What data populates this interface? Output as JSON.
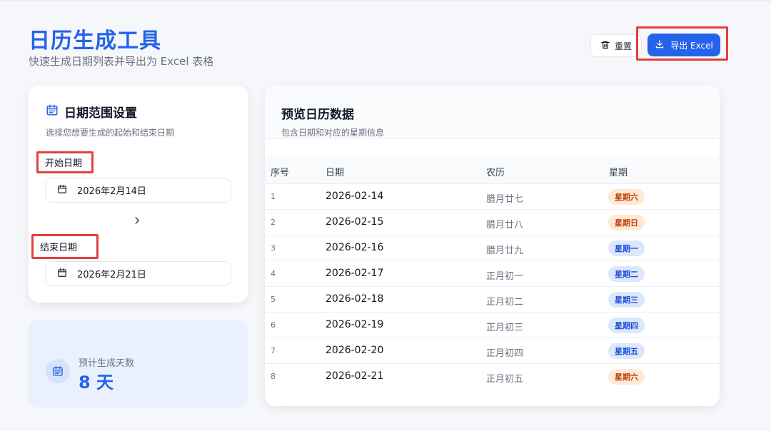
{
  "header": {
    "title": "日历生成工具",
    "subtitle": "快速生成日期列表并导出为 Excel 表格",
    "reset_label": "重置",
    "export_label": "导出 Excel"
  },
  "settings": {
    "title": "日期范围设置",
    "description": "选择您想要生成的起始和结束日期",
    "start_label": "开始日期",
    "start_value": "2026年2月14日",
    "end_label": "结束日期",
    "end_value": "2026年2月21日"
  },
  "summary": {
    "label": "预计生成天数",
    "value": "8 天"
  },
  "preview": {
    "title": "预览日历数据",
    "description": "包含日期和对应的星期信息",
    "columns": [
      "序号",
      "日期",
      "农历",
      "星期"
    ],
    "rows": [
      {
        "idx": "1",
        "date": "2026-02-14",
        "lunar": "腊月廿七",
        "weekday": "星期六",
        "type": "weekend"
      },
      {
        "idx": "2",
        "date": "2026-02-15",
        "lunar": "腊月廿八",
        "weekday": "星期日",
        "type": "weekend"
      },
      {
        "idx": "3",
        "date": "2026-02-16",
        "lunar": "腊月廿九",
        "weekday": "星期一",
        "type": "weekday"
      },
      {
        "idx": "4",
        "date": "2026-02-17",
        "lunar": "正月初一",
        "weekday": "星期二",
        "type": "weekday"
      },
      {
        "idx": "5",
        "date": "2026-02-18",
        "lunar": "正月初二",
        "weekday": "星期三",
        "type": "weekday"
      },
      {
        "idx": "6",
        "date": "2026-02-19",
        "lunar": "正月初三",
        "weekday": "星期四",
        "type": "weekday"
      },
      {
        "idx": "7",
        "date": "2026-02-20",
        "lunar": "正月初四",
        "weekday": "星期五",
        "type": "weekday"
      },
      {
        "idx": "8",
        "date": "2026-02-21",
        "lunar": "正月初五",
        "weekday": "星期六",
        "type": "weekend"
      }
    ]
  },
  "colors": {
    "accent": "#2563eb",
    "highlight_box": "#e53e3e",
    "weekend_badge_bg": "#fde9d5",
    "weekend_badge_text": "#c2410c",
    "weekday_badge_bg": "#dbe7fb",
    "weekday_badge_text": "#1d4ed8"
  },
  "icons": {
    "settings_title": "calendar-icon",
    "reset": "trash-icon",
    "export": "download-icon",
    "date_field": "calendar-icon",
    "range_arrow": "chevron-right-icon",
    "summary": "calendar-icon"
  }
}
